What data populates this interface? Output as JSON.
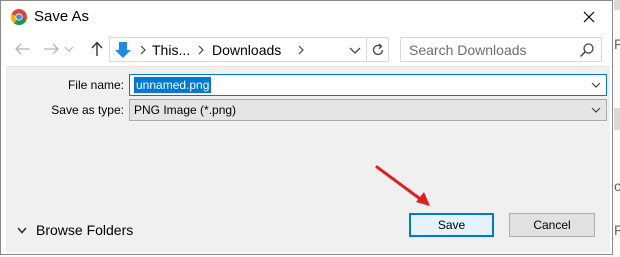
{
  "window": {
    "title": "Save As",
    "icon": "chrome-icon"
  },
  "nav": {
    "back_icon": "arrow-left-icon",
    "forward_icon": "arrow-right-icon",
    "dropdown_icon": "chevron-down-icon",
    "up_icon": "arrow-up-icon"
  },
  "address": {
    "crumbs": [
      "This...",
      "Downloads"
    ],
    "refresh_icon": "refresh-icon"
  },
  "search": {
    "placeholder": "Search Downloads"
  },
  "form": {
    "file_name_label": "File name:",
    "file_name_value": "unnamed.png",
    "save_type_label": "Save as type:",
    "save_type_value": "PNG Image (*.png)"
  },
  "footer": {
    "browse_label": "Browse Folders",
    "save_label": "Save",
    "cancel_label": "Cancel"
  },
  "background": {
    "edge_text": [
      "Fe",
      "c",
      "F"
    ]
  },
  "colors": {
    "accent": "#0078d7",
    "pane": "#f0f0f0",
    "annotation": "#e02020"
  }
}
